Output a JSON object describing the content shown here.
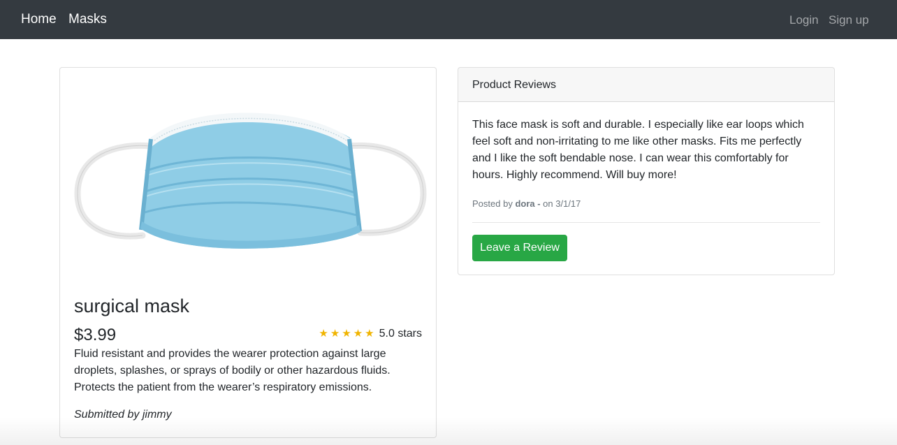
{
  "navbar": {
    "home": "Home",
    "masks": "Masks",
    "login": "Login",
    "signup": "Sign up"
  },
  "product": {
    "title": "surgical mask",
    "price": "$3.99",
    "stars": "★★★★★",
    "rating_label": "5.0 stars",
    "description": "Fluid resistant and provides the wearer protection against large droplets, splashes, or sprays of bodily or other hazardous fluids. Protects the patient from the wearer’s respiratory emissions.",
    "submitted_by": "Submitted by jimmy"
  },
  "reviews": {
    "header": "Product Reviews",
    "items": [
      {
        "text": "This face mask is soft and durable. I especially like ear loops which feel soft and non-irritating to me like other masks. Fits me perfectly and I like the soft bendable nose. I can wear this comfortably for hours. Highly recommend. Will buy more!",
        "posted_prefix": "Posted by ",
        "author": "dora -",
        "date_text": " on 3/1/17"
      }
    ],
    "button_label": "Leave a Review"
  },
  "colors": {
    "navbar_bg": "#343a40",
    "button_green": "#28a745",
    "star_color": "#f0b400"
  }
}
